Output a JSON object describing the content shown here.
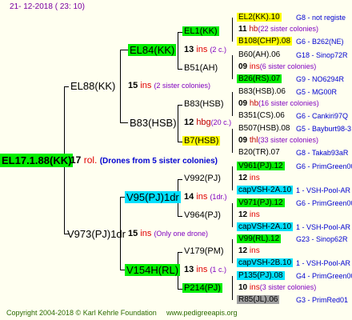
{
  "header": {
    "date": "21- 12-2018 (  23: 10)"
  },
  "footer": {
    "copyright": "Copyright 2004-2018 © Karl Kehrle Foundation",
    "site": "www.pedigreeapis.org"
  },
  "root": {
    "name": "EL17.1.88(KK)",
    "count": "17",
    "label": "rol.",
    "note": "(Drones from 5 sister colonies)"
  },
  "gen1": [
    {
      "name": "EL88(KK)",
      "count": "15",
      "label": "ins",
      "note": "(2 sister colonies)"
    },
    {
      "name": "V973(PJ)1dr",
      "count": "15",
      "label": "ins",
      "note": "(Only one drone)"
    }
  ],
  "gen2": [
    {
      "name": "EL84(KK)",
      "count": "13",
      "label": "ins",
      "note": "(2 c.)"
    },
    {
      "name": "B83(HSB)",
      "count": "12",
      "label": "hbg",
      "note": "(20 c.)"
    },
    {
      "name": "V95(PJ)1dr",
      "count": "14",
      "label": "ins",
      "note": "(1dr.)"
    },
    {
      "name": "V154H(RL)",
      "count": "13",
      "label": "ins",
      "note": "(1 c.)"
    }
  ],
  "gen3": [
    {
      "name": "EL1(KK)"
    },
    {
      "name": "B51(AH)"
    },
    {
      "name": "B83(HSB)"
    },
    {
      "name": "B7(HSB)"
    },
    {
      "name": "V992(PJ)"
    },
    {
      "name": "V964(PJ)"
    },
    {
      "name": "V179(PM)"
    },
    {
      "name": "P214(PJ)"
    }
  ],
  "gen4": [
    {
      "mother": "EL2(KK).10",
      "count": "11",
      "label": "hb",
      "note": "(22 sister colonies)",
      "father": "B108(CHP).08",
      "mref": "G8 - not registe",
      "fref": "G6 - B262(NE)"
    },
    {
      "mother": "B60(AH).06",
      "count": "09",
      "label": "ins",
      "note": "(6 sister colonies)",
      "father": "B26(RS).07",
      "mref": "G18 - Sinop72R",
      "fref": "G9 - NO6294R"
    },
    {
      "mother": "B83(HSB).06",
      "count": "09",
      "label": "hb",
      "note": "(16 sister colonies)",
      "father": "B351(CS).06",
      "mref": "G5 - MG00R",
      "fref": "G6 - Cankiri97Q"
    },
    {
      "mother": "B507(HSB).08",
      "count": "09",
      "label": "thl",
      "note": "(33 sister colonies)",
      "father": "B20(TR).07",
      "mref": "G5 - Bayburt98-3",
      "fref": "G8 - Takab93aR"
    },
    {
      "mother": "V961(PJ).12",
      "count": "12",
      "label": "ins",
      "note": "",
      "father": "capVSH-2A.10",
      "mref": "G6 - PrimGreen00",
      "fref": "1 - VSH-Pool-AR"
    },
    {
      "mother": "V971(PJ).12",
      "count": "12",
      "label": "ins",
      "note": "",
      "father": "capVSH-2A.10",
      "mref": "G6 - PrimGreen00",
      "fref": "1 - VSH-Pool-AR"
    },
    {
      "mother": "V99(RL).12",
      "count": "12",
      "label": "ins",
      "note": "",
      "father": "capVSH-2B.10",
      "mref": "G23 - Sinop62R",
      "fref": "1 - VSH-Pool-AR"
    },
    {
      "mother": "P135(PJ).08",
      "count": "10",
      "label": "ins",
      "note": "(3 sister colonies)",
      "father": "R85(JL).06",
      "mref": "G4 - PrimGreen00",
      "fref": "G3 - PrimRed01"
    }
  ]
}
